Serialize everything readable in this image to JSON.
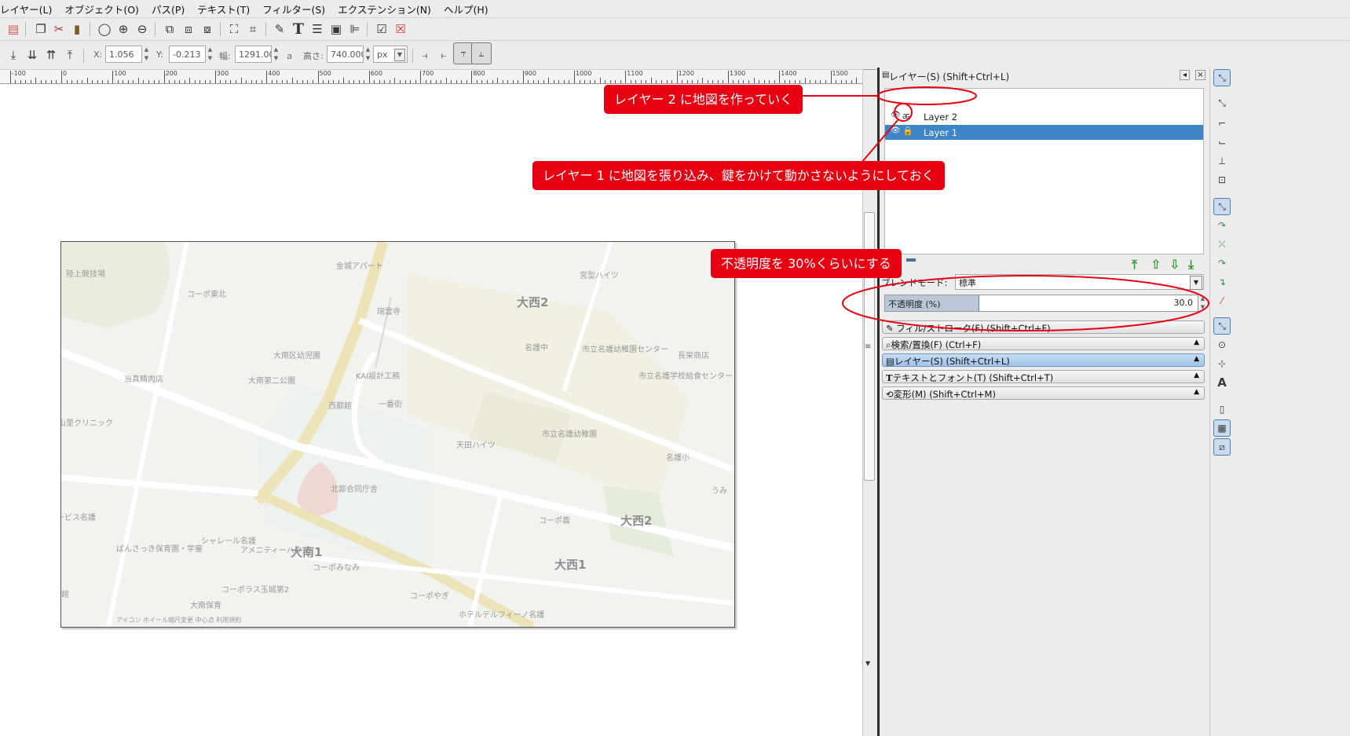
{
  "menubar": {
    "items": [
      "レイヤー(L)",
      "オブジェクト(O)",
      "パス(P)",
      "テキスト(T)",
      "フィルター(S)",
      "エクステンション(N)",
      "ヘルプ(H)"
    ]
  },
  "toolbar_icons": [
    "document-icon",
    "delete-icon",
    "duplicate-icon",
    "cut-icon",
    "paste-icon",
    "zoom-icon",
    "zoom-in-icon",
    "zoom-out-icon",
    "copy-icon",
    "clone-icon",
    "unlink-icon",
    "group-icon",
    "ungroup-icon",
    "xml-editor-icon",
    "text-tool-icon",
    "layers-icon",
    "objects-icon",
    "align-icon",
    "preferences-icon",
    "close-icon"
  ],
  "controls": {
    "x_label": "X:",
    "x_value": "1.056",
    "y_label": "Y:",
    "y_value": "-0.213",
    "w_label": "幅:",
    "w_value": "1291.00",
    "lock_glyph": "ａ",
    "h_label": "高さ:",
    "h_value": "740.000",
    "unit": "px"
  },
  "ruler": {
    "labels": [
      "-100",
      "0",
      "100",
      "200",
      "300",
      "400",
      "500",
      "600",
      "700",
      "800",
      "900",
      "1000",
      "1100",
      "1200",
      "1300",
      "1400",
      "1500"
    ]
  },
  "map": {
    "labels": [
      {
        "text": "陸上競技場",
        "big": false
      },
      {
        "text": "コーポ東北",
        "big": false
      },
      {
        "text": "金城アパート",
        "big": false
      },
      {
        "text": "瑞雲寺",
        "big": false
      },
      {
        "text": "宮型ハイツ",
        "big": false
      },
      {
        "text": "大西2",
        "big": true
      },
      {
        "text": "名護中",
        "big": false
      },
      {
        "text": "市立名護幼稚園センター",
        "big": false
      },
      {
        "text": "長栄商店",
        "big": false
      },
      {
        "text": "大南区幼児園",
        "big": false
      },
      {
        "text": "大南第二公園",
        "big": false
      },
      {
        "text": "KAI設計工務",
        "big": false
      },
      {
        "text": "当真精肉店",
        "big": false
      },
      {
        "text": "西都館",
        "big": false
      },
      {
        "text": "一番街",
        "big": false
      },
      {
        "text": "市立名護学校給食センター",
        "big": false
      },
      {
        "text": "山里クリニック",
        "big": false
      },
      {
        "text": "天田ハイツ",
        "big": false
      },
      {
        "text": "市立名護幼稚園",
        "big": false
      },
      {
        "text": "名護小",
        "big": false
      },
      {
        "text": "北部合同庁舎",
        "big": false
      },
      {
        "text": "コーポ嘉",
        "big": false
      },
      {
        "text": "大西2",
        "big": true
      },
      {
        "text": "ービス名護",
        "big": false
      },
      {
        "text": "シャレール名護",
        "big": false
      },
      {
        "text": "アメニティーハウス",
        "big": false
      },
      {
        "text": "大南1",
        "big": true
      },
      {
        "text": "コーポみなみ",
        "big": false
      },
      {
        "text": "大西1",
        "big": true
      },
      {
        "text": "ぱんさっき保育園・学童",
        "big": false
      },
      {
        "text": "コーポラス玉城第2",
        "big": false
      },
      {
        "text": "コーポやぎ",
        "big": false
      },
      {
        "text": "大南保育",
        "big": false
      },
      {
        "text": "ホテルデルフィーノ名護",
        "big": false
      },
      {
        "text": "うみ",
        "big": false
      },
      {
        "text": "館",
        "big": false
      }
    ],
    "footer": "アイコン  ホイール縮尺変更  中心点  利用規約"
  },
  "dock": {
    "title": "レイヤー(S) (Shift+Ctrl+L)",
    "layers": [
      {
        "name": "Layer 2",
        "selected": false
      },
      {
        "name": "Layer 1",
        "selected": true
      }
    ],
    "blend_label": "ブレンドモード:",
    "blend_value": "標準",
    "opacity_label": "不透明度 (%)",
    "opacity_value": "30.0",
    "opacity_fraction": 0.3,
    "dialogs": [
      {
        "label": "フィル/ストローク(F) (Shift+Ctrl+F)",
        "caret": "",
        "active": false
      },
      {
        "label": "検索/置換(F) (Ctrl+F)",
        "caret": "▲",
        "active": false
      },
      {
        "label": "レイヤー(S) (Shift+Ctrl+L)",
        "caret": "▲",
        "active": true
      },
      {
        "label": "テキストとフォント(T) (Shift+Ctrl+T)",
        "caret": "▲",
        "active": false
      },
      {
        "label": "変形(M) (Shift+Ctrl+M)",
        "caret": "▲",
        "active": false
      }
    ]
  },
  "annotations": {
    "callout_layer2": "レイヤー 2 に地図を作っていく",
    "callout_layer1": "レイヤー 1 に地図を張り込み、鍵をかけて動かさないようにしておく",
    "callout_opacity": "不透明度を 30%くらいにする",
    "color": "#e60012"
  },
  "colors": {
    "selection": "#3d85c6",
    "opacity_bar": "#b9c7d6",
    "annotation": "#e60012"
  }
}
